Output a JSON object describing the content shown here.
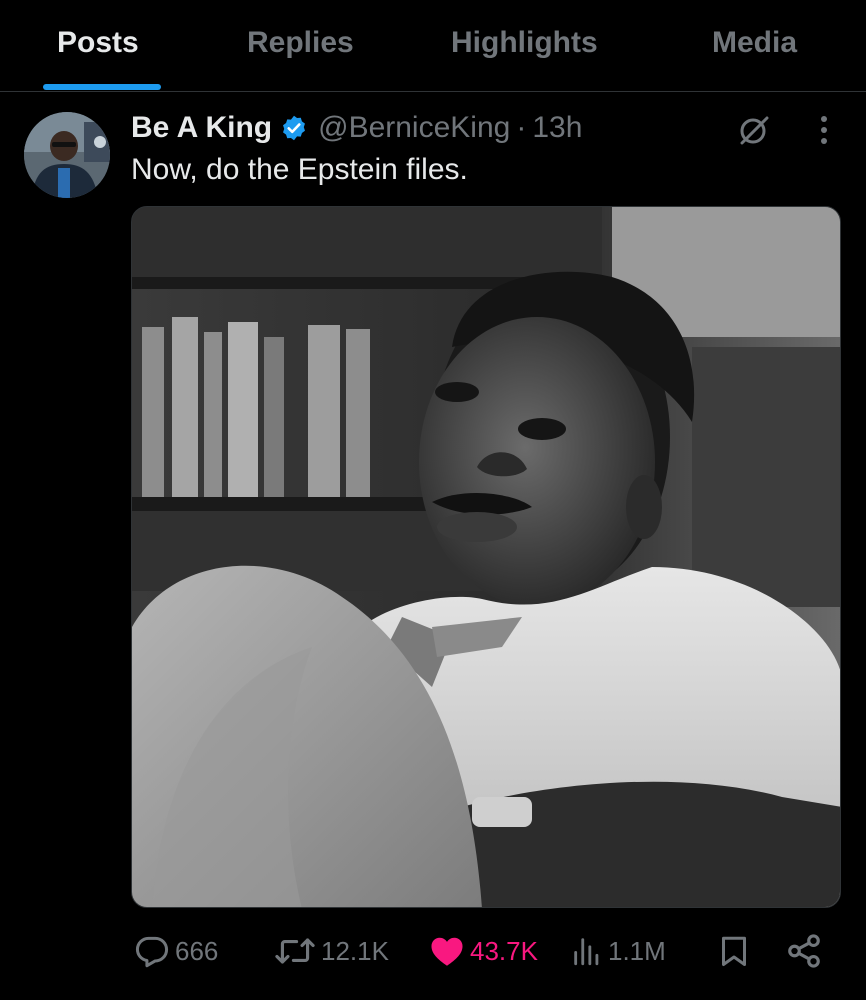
{
  "tabs": [
    {
      "label": "Posts",
      "active": true
    },
    {
      "label": "Replies",
      "active": false
    },
    {
      "label": "Highlights",
      "active": false
    },
    {
      "label": "Media",
      "active": false
    }
  ],
  "post": {
    "display_name": "Be A King",
    "handle": "@BerniceKing",
    "separator": "·",
    "time": "13h",
    "verified": true,
    "text": "Now, do the Epstein files.",
    "media": {
      "type": "photo",
      "style": "black-and-white portrait"
    }
  },
  "actions": {
    "replies": "666",
    "reposts": "12.1K",
    "likes": "43.7K",
    "views": "1.1M"
  },
  "icons": {
    "verified": "verified-badge-icon",
    "grok": "grok-icon",
    "more": "more-vertical-icon",
    "reply": "reply-icon",
    "repost": "repost-icon",
    "like": "heart-filled-icon",
    "views": "views-icon",
    "bookmark": "bookmark-icon",
    "share": "share-icon"
  },
  "colors": {
    "background": "#000000",
    "text_primary": "#e7e9ea",
    "text_secondary": "#71767b",
    "accent": "#1d9bf0",
    "like": "#f91880",
    "divider": "#2f3336"
  }
}
